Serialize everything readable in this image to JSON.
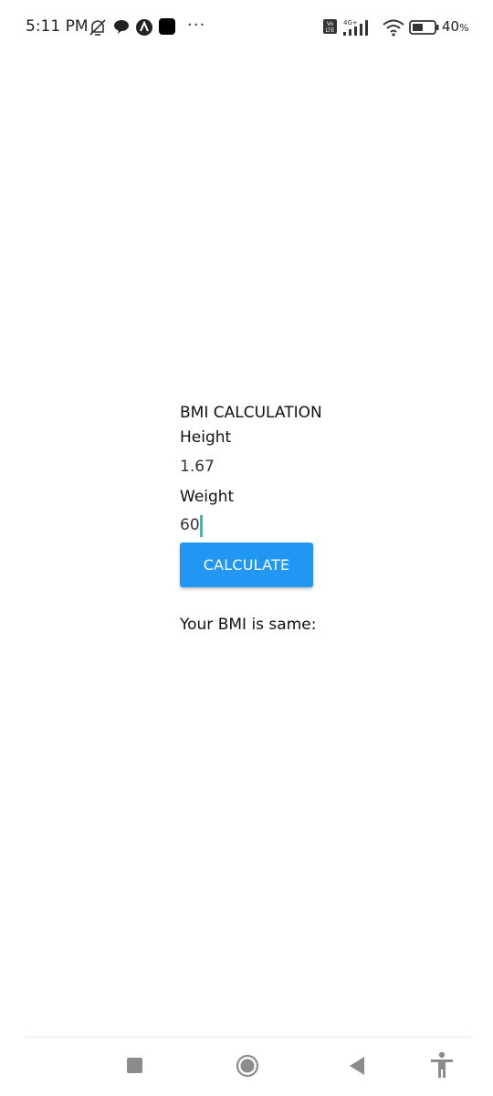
{
  "status_bar": {
    "time": "5:11 PM",
    "battery_percent": "40",
    "battery_suffix": "%",
    "network_label": "4G+",
    "volte_label": "Vo\nLTE",
    "icons": [
      "muted-bell-icon",
      "chat-bubble-icon",
      "app-lambda-icon",
      "app-black-square-icon",
      "more-dots-icon",
      "volte-icon",
      "signal-icon",
      "wifi-icon",
      "battery-icon"
    ]
  },
  "app": {
    "title": "BMI CALCULATION",
    "height_label": "Height",
    "height_value": "1.67",
    "weight_label": "Weight",
    "weight_value": "60",
    "calculate_button": "CALCULATE",
    "result_text": "Your BMI is same:"
  },
  "nav_bar": {
    "icons": [
      "recents-square-icon",
      "home-circle-icon",
      "back-triangle-icon",
      "accessibility-icon"
    ]
  },
  "colors": {
    "button": "#2196F3",
    "caret": "#27c4b8",
    "nav_icons": "#8c8c8c"
  }
}
